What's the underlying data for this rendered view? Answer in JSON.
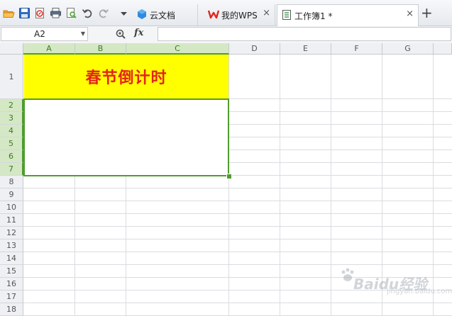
{
  "toolbar": {
    "icons": [
      "open-icon",
      "save-icon",
      "export-pdf-icon",
      "print-icon",
      "print-preview-icon",
      "undo-icon",
      "redo-icon",
      "more-dropdown-icon"
    ]
  },
  "tabs": [
    {
      "label": "云文档",
      "active": false,
      "icon": "cloud-docs-icon",
      "closable": false
    },
    {
      "label": "我的WPS",
      "active": false,
      "icon": "wps-logo-icon",
      "closable": true
    },
    {
      "label": "工作簿1 *",
      "active": true,
      "icon": "workbook-icon",
      "closable": true
    }
  ],
  "close_glyph": "×",
  "add_glyph": "+",
  "formula_bar": {
    "cell_ref": "A2",
    "dropdown_glyph": "▼",
    "fx_label": "fx",
    "formula_value": ""
  },
  "sheet": {
    "columns": [
      "A",
      "B",
      "C",
      "D",
      "E",
      "F",
      "G"
    ],
    "rows": [
      "1",
      "2",
      "3",
      "4",
      "5",
      "6",
      "7",
      "8",
      "9",
      "10",
      "11",
      "12",
      "13",
      "14",
      "15",
      "16",
      "17",
      "18"
    ],
    "selected_columns": [
      "A",
      "B",
      "C"
    ],
    "selected_rows": [
      "2",
      "3",
      "4",
      "5",
      "6",
      "7"
    ],
    "merged_title": {
      "range": "A1:C1",
      "text": "春节倒计时",
      "fill": "#ffff00",
      "text_color": "#e5231b"
    },
    "selection_range": "A2:C7",
    "selection_color": "#4f9d2f"
  },
  "watermark": {
    "text": "Baidu经验",
    "sub": "jingyan.baidu.com"
  }
}
